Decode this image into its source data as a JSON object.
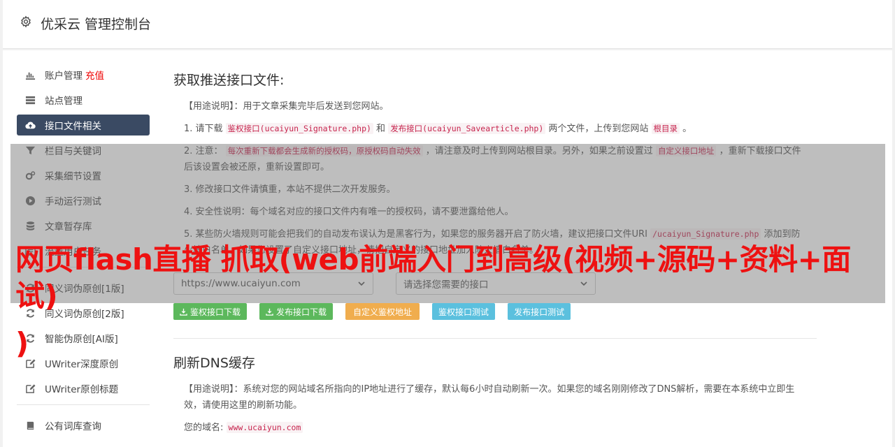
{
  "header": {
    "title": "优采云 管理控制台"
  },
  "sidebar": {
    "group1": [
      {
        "label": "账户管理",
        "badge": "充值",
        "icon": "bar-chart-icon"
      },
      {
        "label": "站点管理",
        "icon": "server-icon"
      },
      {
        "label": "接口文件相关",
        "icon": "cloud-upload-icon",
        "active": true
      },
      {
        "label": "栏目与关键词",
        "icon": "filter-icon"
      },
      {
        "label": "采集细节设置",
        "icon": "cogs-icon"
      },
      {
        "label": "手动运行测试",
        "icon": "play-circle-icon"
      },
      {
        "label": "文章暂存库",
        "icon": "database-icon"
      },
      {
        "label": "流量用户任务",
        "icon": "tasks-icon"
      }
    ],
    "group2": [
      {
        "label": "同义词伪原创[1版]",
        "icon": "refresh-icon"
      },
      {
        "label": "同义词伪原创[2版]",
        "icon": "refresh-icon"
      },
      {
        "label": "智能伪原创[AI版]",
        "icon": "refresh-icon"
      },
      {
        "label": "UWriter深度原创",
        "icon": "edit-icon"
      },
      {
        "label": "UWriter原创标题",
        "icon": "edit-icon"
      }
    ],
    "group3": [
      {
        "label": "公有词库查询",
        "icon": "book-icon"
      }
    ]
  },
  "section1": {
    "title": "获取推送接口文件:",
    "usage": "【用途说明】：用于文章采集完毕后发送到您网站。",
    "p1": {
      "a": "1. 请下载 ",
      "c1": "鉴权接口(ucaiyun_Signature.php)",
      "b": " 和 ",
      "c2": "发布接口(ucaiyun_Savearticle.php)",
      "d": " 两个文件，上传到您网站 ",
      "c3": "根目录",
      "e": " 。"
    },
    "p2": {
      "a": "2. 注意： ",
      "c1": "每次重新下载都会生成新的授权码，原授权码自动失效",
      "b": " ，请注意及时上传到网站根目录。另外，如果之前设置过 ",
      "c2": "自定义接口地址",
      "d": " ，重新下载接口文件后该设置会被还原，重新设置即可。"
    },
    "p3": "3. 修改接口文件请慎重，本站不提供二次开发服务。",
    "p4": "4. 安全性说明：每个域名对应的接口文件内有唯一的授权码，请不要泄露给他人。",
    "p5": {
      "a": "5. 某些防火墙规则可能会把我们的自动发布误认为是黑客行为，如果您的服务器开启了防火墙，建议把接口文件URI ",
      "c1": "/ucaiyun_Signature.php",
      "b": " 添加到防火墙白名单，如果您设置了自定义接口地址，请把自定义的接口地址加入防火墙白名单。"
    },
    "select_site": "https://www.ucaiyun.com",
    "select_api": "请选择您需要的接口",
    "buttons": {
      "auth_download": "鉴权接口下载",
      "publish_download": "发布接口下载",
      "custom_auth": "自定义鉴权地址",
      "auth_test": "鉴权接口测试",
      "publish_test": "发布接口测试"
    }
  },
  "section2": {
    "title": "刷新DNS缓存",
    "usage": "【用途说明】：系统对您的网站域名所指向的IP地址进行了缓存，默认每6小时自动刷新一次。如果您的域名刚刚修改了DNS解析，需要在本系统中立即生效，请使用这里的刷新功能。",
    "domain_label": "您的域名: ",
    "domain_value": "www.ucaiyun.com"
  },
  "watermark": {
    "line1": "网页flash直播 抓取(web前端入门到高级(视频+源码+资料+面试)",
    "line2": ")"
  }
}
